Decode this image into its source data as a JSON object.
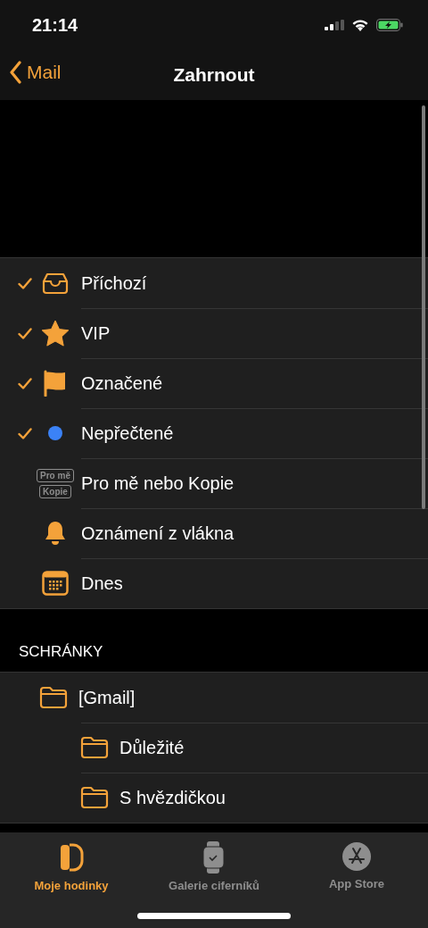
{
  "status_bar": {
    "time": "21:14"
  },
  "nav": {
    "back": "Mail",
    "title": "Zahrnout"
  },
  "filters": [
    {
      "kind": "inbox",
      "label": "Příchozí",
      "checked": true
    },
    {
      "kind": "star",
      "label": "VIP",
      "checked": true
    },
    {
      "kind": "flag",
      "label": "Označené",
      "checked": true
    },
    {
      "kind": "dot",
      "label": "Nepřečtené",
      "checked": true
    },
    {
      "kind": "badges",
      "label": "Pro mě nebo Kopie",
      "checked": false,
      "badge_lines": [
        "Pro mě",
        "Kopie"
      ]
    },
    {
      "kind": "bell",
      "label": "Oznámení z vlákna",
      "checked": false
    },
    {
      "kind": "calendar",
      "label": "Dnes",
      "checked": false
    }
  ],
  "mailboxes_header": "SCHRÁNKY",
  "mailboxes": [
    {
      "label": "[Gmail]",
      "children": [
        {
          "label": "Důležité"
        },
        {
          "label": "S hvězdičkou"
        }
      ]
    }
  ],
  "tabs": [
    {
      "kind": "watch",
      "label": "Moje hodinky",
      "selected": true
    },
    {
      "kind": "faces",
      "label": "Galerie ciferníků",
      "selected": false
    },
    {
      "kind": "store",
      "label": "App Store",
      "selected": false
    }
  ]
}
